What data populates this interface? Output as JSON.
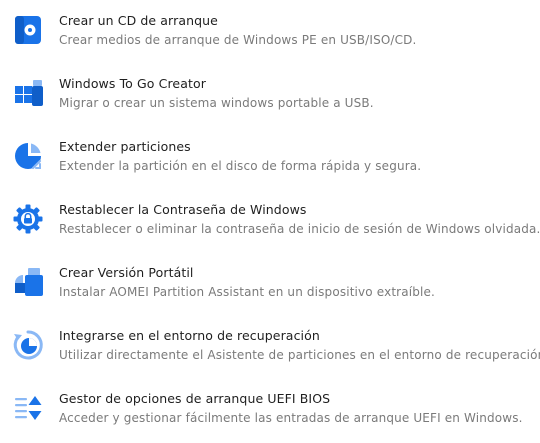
{
  "accent_color": "#1a73e8",
  "items": [
    {
      "title": "Crear un CD de arranque",
      "description": "Crear medios de arranque de Windows PE en USB/ISO/CD.",
      "icon": "bootable-disc-icon"
    },
    {
      "title": "Windows To Go Creator",
      "description": "Migrar o crear un sistema windows portable a USB.",
      "icon": "windows-to-go-icon"
    },
    {
      "title": "Extender particiones",
      "description": "Extender la partición en el disco de forma rápida y segura.",
      "icon": "extend-partition-icon"
    },
    {
      "title": "Restablecer la Contraseña de Windows",
      "description": "Restablecer o eliminar la contraseña de inicio de sesión de Windows olvidada.",
      "icon": "password-reset-gear-icon"
    },
    {
      "title": "Crear Versión Portátil",
      "description": "Instalar AOMEI Partition Assistant en un dispositivo extraíble.",
      "icon": "portable-version-icon"
    },
    {
      "title": "Integrarse en el entorno de recuperación",
      "description": "Utilizar directamente el Asistente de particiones en el entorno de recuperación.",
      "icon": "recovery-environment-icon"
    },
    {
      "title": "Gestor de opciones de arranque UEFI BIOS",
      "description": "Acceder y gestionar fácilmente las entradas de arranque UEFI en Windows.",
      "icon": "uefi-boot-manager-icon"
    }
  ]
}
